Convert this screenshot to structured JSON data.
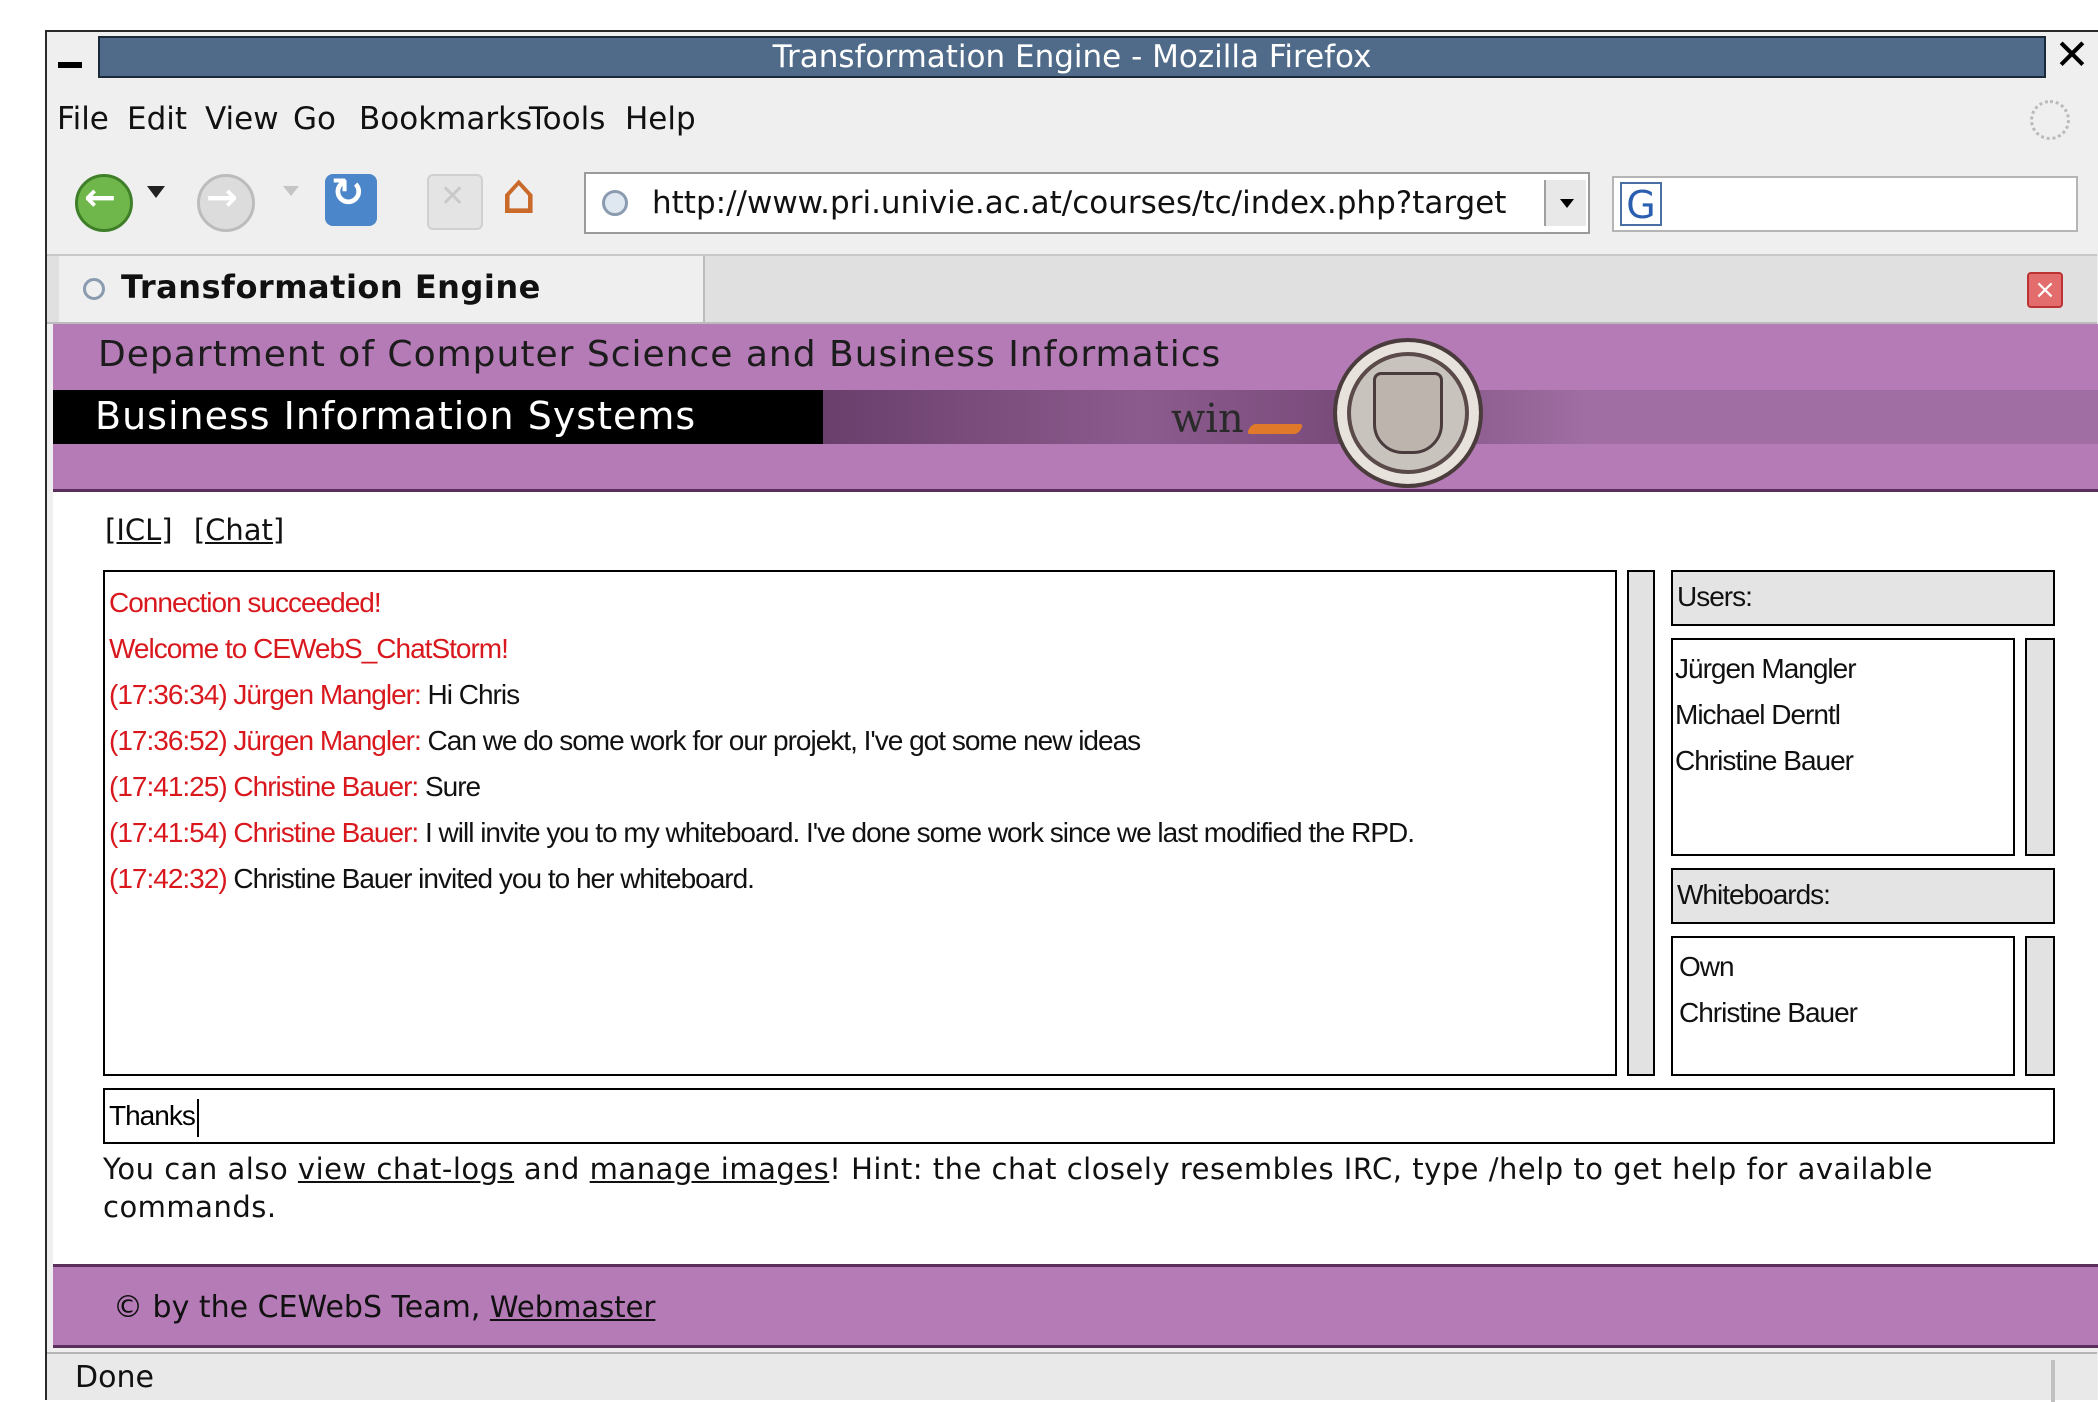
{
  "window": {
    "title": "Transformation Engine - Mozilla Firefox",
    "close_glyph": "✕"
  },
  "menu": {
    "items": [
      "File",
      "Edit",
      "View",
      "Go",
      "Bookmarks",
      "Tools",
      "Help"
    ]
  },
  "toolbar": {
    "url": "http://www.pri.univie.ac.at/courses/tc/index.php?target",
    "search_engine_glyph": "G",
    "search_value": ""
  },
  "tabs": {
    "active_title": "Transformation Engine"
  },
  "banner": {
    "department": "Department of Computer Science and Business Informatics",
    "group": "Business Information Systems",
    "logo_text": "win"
  },
  "page_links": [
    {
      "label": "[ICL]"
    },
    {
      "label": "[Chat]"
    }
  ],
  "chat": {
    "system_lines": [
      "Connection succeeded!",
      "Welcome to CEWebS_ChatStorm!"
    ],
    "messages": [
      {
        "time": "(17:36:34)",
        "nick": "Jürgen Mangler:",
        "text": "Hi Chris"
      },
      {
        "time": "(17:36:52)",
        "nick": "Jürgen Mangler:",
        "text": "Can we do some work for our projekt, I've got some new ideas"
      },
      {
        "time": "(17:41:25)",
        "nick": "Christine Bauer:",
        "text": "Sure"
      },
      {
        "time": "(17:41:54)",
        "nick": "Christine Bauer:",
        "text": "I will invite you to my whiteboard. I've done some work since we last modified the RPD."
      },
      {
        "time": "(17:42:32)",
        "nick": "",
        "text": "Christine Bauer invited you to her whiteboard."
      }
    ],
    "input_value": "Thanks"
  },
  "sidebar": {
    "users_header": "Users:",
    "users": [
      "Jürgen Mangler",
      "Michael Derntl",
      "Christine Bauer"
    ],
    "whiteboards_header": "Whiteboards:",
    "whiteboards": [
      "Own",
      "Christine Bauer"
    ]
  },
  "hint": {
    "prefix": "You can also ",
    "link1": "view chat-logs",
    "middle": " and ",
    "link2": "manage images",
    "suffix": "! Hint: the chat closely resembles IRC, type /help to get help for available commands."
  },
  "footer": {
    "text": "© by the CEWebS Team, ",
    "link": "Webmaster"
  },
  "status": {
    "text": "Done"
  },
  "colors": {
    "banner_purple": "#b47bb6",
    "titlebar_blue": "#4f6b89",
    "chat_red": "#d9181e"
  }
}
